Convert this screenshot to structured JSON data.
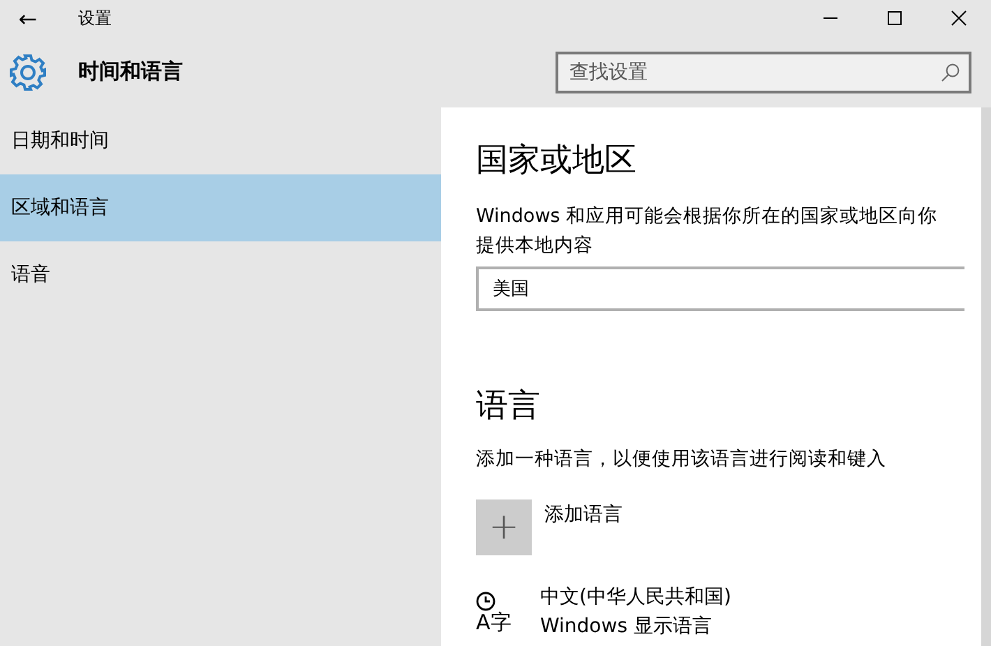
{
  "window": {
    "title": "设置",
    "back": "←"
  },
  "header": {
    "title": "时间和语言",
    "search": {
      "placeholder": "查找设置"
    }
  },
  "sidebar": {
    "items": [
      {
        "label": "日期和时间",
        "selected": false
      },
      {
        "label": "区域和语言",
        "selected": true
      },
      {
        "label": "语音",
        "selected": false
      }
    ]
  },
  "region": {
    "heading": "国家或地区",
    "description": "Windows 和应用可能会根据你所在的国家或地区向你提供本地内容",
    "value": "美国"
  },
  "language": {
    "heading": "语言",
    "description": "添加一种语言，以便使用该语言进行阅读和键入",
    "add": {
      "icon": "+",
      "label": "添加语言"
    },
    "items": [
      {
        "icon_glyph": "A字",
        "name": "中文(中华人民共和国)",
        "detail": "Windows 显示语言"
      }
    ]
  }
}
